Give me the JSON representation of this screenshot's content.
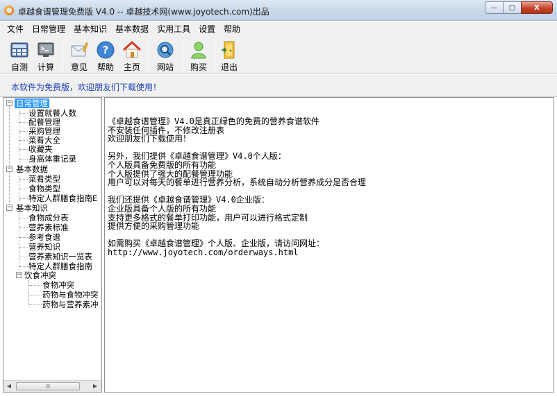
{
  "window": {
    "title": "卓越食谱管理免费版 V4.0 -- 卓越技术网(www.joyotech.com)出品",
    "minimize_glyph": "—",
    "maximize_glyph": "□",
    "close_glyph": "X"
  },
  "menu": [
    "文件",
    "日常管理",
    "基本知识",
    "基本数据",
    "实用工具",
    "设置",
    "帮助"
  ],
  "toolbar": [
    {
      "label": "自测",
      "icon": "calculator-grid-icon"
    },
    {
      "label": "计算",
      "icon": "monitor-icon"
    },
    {
      "label": "意见",
      "icon": "mail-icon"
    },
    {
      "label": "帮助",
      "icon": "help-icon"
    },
    {
      "label": "主页",
      "icon": "home-icon"
    },
    {
      "label": "网站",
      "icon": "globe-search-icon"
    },
    {
      "label": "购买",
      "icon": "user-icon"
    },
    {
      "label": "退出",
      "icon": "exit-door-icon"
    }
  ],
  "notice": "本软件为免费版，欢迎朋友们下载使用！",
  "tree": {
    "daily": {
      "label": "日常管理",
      "children": [
        "设置就餐人数",
        "配餐管理",
        "采购管理",
        "菜肴大全",
        "收藏夹",
        "身高体重记录"
      ]
    },
    "basic_data": {
      "label": "基本数据",
      "children": [
        "菜肴类型",
        "食物类型",
        "特定人群膳食指南E"
      ]
    },
    "basic_knowledge": {
      "label": "基本知识",
      "children": [
        "食物成分表",
        "营养素标准",
        "参考食谱",
        "营养知识",
        "营养素知识一览表",
        "特定人群膳食指南"
      ],
      "conflict": {
        "label": "饮食冲突",
        "children": [
          "食物冲突",
          "药物与食物冲突",
          "药物与营养素冲"
        ]
      }
    }
  },
  "scrollbar": {
    "left": "◀",
    "thumb": "III",
    "right": "▶"
  },
  "content": {
    "lines": [
      "《卓越食谱管理》V4.0是真正绿色的免费的营养食谱软件",
      "不安装任何插件，不修改注册表",
      "欢迎朋友们下载使用！",
      "",
      "另外，我们提供《卓越食谱管理》V4.0个人版：",
      "个人版具备免费版的所有功能",
      "个人版提供了强大的配餐管理功能",
      "用户可以对每天的餐单进行营养分析，系统自动分析营养成分是否合理",
      "",
      "我们还提供《卓越食谱管理》V4.0企业版：",
      "企业版具备个人版的所有功能",
      "支持更多格式的餐单打印功能，用户可以进行格式定制",
      "提供方便的采购管理功能",
      "",
      "如需购买《卓越食谱管理》个人版、企业版，请访问网址：",
      "http://www.joyotech.com/orderways.html"
    ]
  },
  "colors": {
    "notice_text": "#1a3fb0",
    "selection": "#3399ff"
  }
}
